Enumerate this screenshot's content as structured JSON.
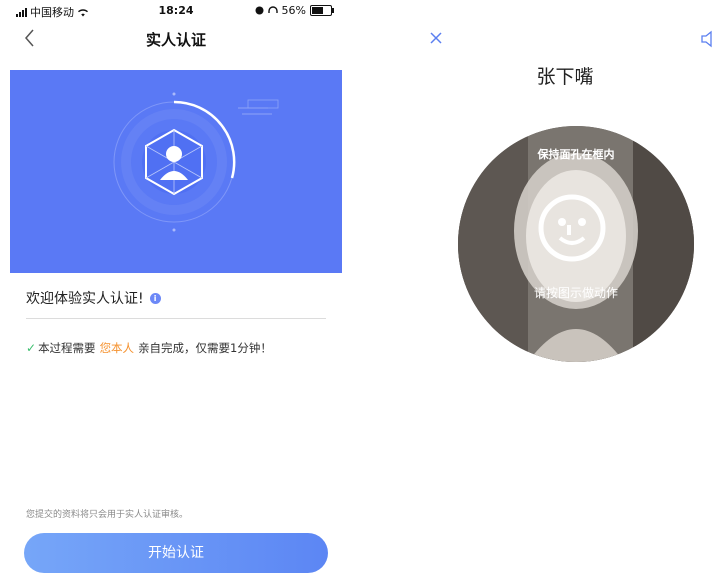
{
  "left_screen": {
    "status_bar": {
      "carrier": "中国移动",
      "time": "18:24",
      "battery": "56%"
    },
    "nav": {
      "title": "实人认证"
    },
    "welcome": "欢迎体验实人认证!",
    "process": {
      "prefix": "本过程需要",
      "highlight": "您本人",
      "suffix": "亲自完成，仅需要1分钟！"
    },
    "disclaimer": "您提交的资料将只会用于实人认证审核。",
    "start_button": "开始认证",
    "colors": {
      "accent": "#5a79f5",
      "highlight": "#f5922f",
      "check": "#3cbf6e"
    }
  },
  "right_screen": {
    "name": "张下嘴",
    "hint_top": "保持面孔在框内",
    "hint_bottom": "请按图示做动作",
    "icons": [
      "close-icon",
      "speaker-icon",
      "face-smile-icon"
    ]
  }
}
